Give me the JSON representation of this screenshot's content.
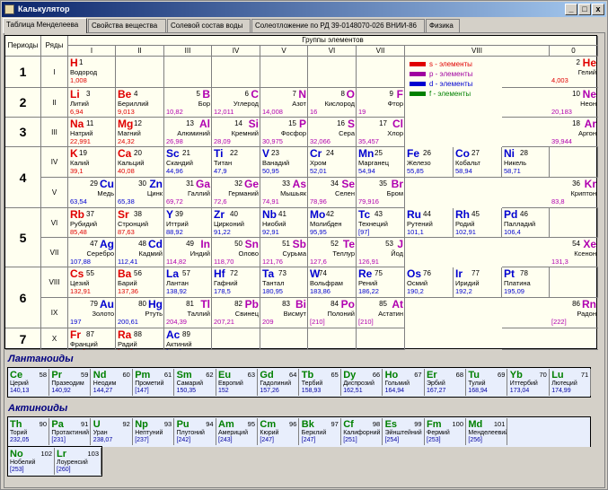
{
  "window": {
    "title": "Калькулятор",
    "min": "_",
    "max": "□",
    "close": "x"
  },
  "tabs": [
    "Таблица Менделеева",
    "Свойства вещества",
    "Солевой состав воды",
    "Солеотложение по РД 39-0148070-026 ВНИИ-86",
    "Физика"
  ],
  "headers": {
    "periods": "Периоды",
    "rows": "Ряды",
    "groups": "Группы элементов",
    "group_nums": [
      "I",
      "II",
      "III",
      "IV",
      "V",
      "VI",
      "VII",
      "VIII",
      "0"
    ]
  },
  "period_labels": [
    "1",
    "2",
    "3",
    "4",
    "5",
    "6",
    "7"
  ],
  "row_labels": [
    "I",
    "II",
    "III",
    "IV",
    "V",
    "VI",
    "VII",
    "VIII",
    "IX",
    "X"
  ],
  "legend": [
    {
      "label": "s - элементы",
      "color": "#e00000"
    },
    {
      "label": "p - элементы",
      "color": "#a000a0"
    },
    {
      "label": "d - элементы",
      "color": "#0000d0"
    },
    {
      "label": "f - элементы",
      "color": "#008000"
    }
  ],
  "colors": {
    "s": "#e00000",
    "p": "#b000b0",
    "d": "#0000d0",
    "f": "#008000"
  },
  "elements": [
    {
      "s": "H",
      "n": "1",
      "name": "Водород",
      "m": "1,008",
      "t": "s",
      "r": 0,
      "c": 0,
      "a": "l"
    },
    {
      "s": "He",
      "n": "2",
      "name": "Гелий",
      "m": "4,003",
      "t": "s",
      "r": 0,
      "c": 9,
      "a": "r"
    },
    {
      "s": "Li",
      "n": "3",
      "name": "Литий",
      "m": "6,94",
      "t": "s",
      "r": 1,
      "c": 0,
      "a": "l"
    },
    {
      "s": "Be",
      "n": "4",
      "name": "Бериллий",
      "m": "9,013",
      "t": "s",
      "r": 1,
      "c": 1,
      "a": "l"
    },
    {
      "s": "B",
      "n": "5",
      "name": "Бор",
      "m": "10,82",
      "t": "p",
      "r": 1,
      "c": 2,
      "a": "r"
    },
    {
      "s": "C",
      "n": "6",
      "name": "Углерод",
      "m": "12,011",
      "t": "p",
      "r": 1,
      "c": 3,
      "a": "r"
    },
    {
      "s": "N",
      "n": "7",
      "name": "Азот",
      "m": "14,008",
      "t": "p",
      "r": 1,
      "c": 4,
      "a": "r"
    },
    {
      "s": "O",
      "n": "8",
      "name": "Кислород",
      "m": "16",
      "t": "p",
      "r": 1,
      "c": 5,
      "a": "r"
    },
    {
      "s": "F",
      "n": "9",
      "name": "Фтор",
      "m": "19",
      "t": "p",
      "r": 1,
      "c": 6,
      "a": "r"
    },
    {
      "s": "Ne",
      "n": "10",
      "name": "Неон",
      "m": "20,183",
      "t": "p",
      "r": 1,
      "c": 9,
      "a": "r"
    },
    {
      "s": "Na",
      "n": "11",
      "name": "Натрий",
      "m": "22,991",
      "t": "s",
      "r": 2,
      "c": 0,
      "a": "l"
    },
    {
      "s": "Mg",
      "n": "12",
      "name": "Магний",
      "m": "24,32",
      "t": "s",
      "r": 2,
      "c": 1,
      "a": "l"
    },
    {
      "s": "Al",
      "n": "13",
      "name": "Алюминий",
      "m": "26,98",
      "t": "p",
      "r": 2,
      "c": 2,
      "a": "r"
    },
    {
      "s": "Si",
      "n": "14",
      "name": "Кремний",
      "m": "28,09",
      "t": "p",
      "r": 2,
      "c": 3,
      "a": "r"
    },
    {
      "s": "P",
      "n": "15",
      "name": "Фосфор",
      "m": "30,975",
      "t": "p",
      "r": 2,
      "c": 4,
      "a": "r"
    },
    {
      "s": "S",
      "n": "16",
      "name": "Сера",
      "m": "32,066",
      "t": "p",
      "r": 2,
      "c": 5,
      "a": "r"
    },
    {
      "s": "Cl",
      "n": "17",
      "name": "Хлор",
      "m": "35,457",
      "t": "p",
      "r": 2,
      "c": 6,
      "a": "r"
    },
    {
      "s": "Ar",
      "n": "18",
      "name": "Аргон",
      "m": "39,944",
      "t": "p",
      "r": 2,
      "c": 9,
      "a": "r"
    },
    {
      "s": "K",
      "n": "19",
      "name": "Калий",
      "m": "39,1",
      "t": "s",
      "r": 3,
      "c": 0,
      "a": "l"
    },
    {
      "s": "Ca",
      "n": "20",
      "name": "Кальций",
      "m": "40,08",
      "t": "s",
      "r": 3,
      "c": 1,
      "a": "l"
    },
    {
      "s": "Sc",
      "n": "21",
      "name": "Скандий",
      "m": "44,96",
      "t": "d",
      "r": 3,
      "c": 2,
      "a": "l"
    },
    {
      "s": "Ti",
      "n": "22",
      "name": "Титан",
      "m": "47,9",
      "t": "d",
      "r": 3,
      "c": 3,
      "a": "l"
    },
    {
      "s": "V",
      "n": "23",
      "name": "Ванадий",
      "m": "50,95",
      "t": "d",
      "r": 3,
      "c": 4,
      "a": "l"
    },
    {
      "s": "Cr",
      "n": "24",
      "name": "Хром",
      "m": "52,01",
      "t": "d",
      "r": 3,
      "c": 5,
      "a": "l"
    },
    {
      "s": "Mn",
      "n": "25",
      "name": "Марганец",
      "m": "54,94",
      "t": "d",
      "r": 3,
      "c": 6,
      "a": "l"
    },
    {
      "s": "Fe",
      "n": "26",
      "name": "Железо",
      "m": "55,85",
      "t": "d",
      "r": 3,
      "c": 7,
      "a": "l"
    },
    {
      "s": "Co",
      "n": "27",
      "name": "Кобальт",
      "m": "58,94",
      "t": "d",
      "r": 3,
      "c": 8,
      "a": "l"
    },
    {
      "s": "Ni",
      "n": "28",
      "name": "Никель",
      "m": "58,71",
      "t": "d",
      "r": 3,
      "c": 10,
      "a": "l"
    },
    {
      "s": "Cu",
      "n": "29",
      "name": "Медь",
      "m": "63,54",
      "t": "d",
      "r": 4,
      "c": 0,
      "a": "r"
    },
    {
      "s": "Zn",
      "n": "30",
      "name": "Цинк",
      "m": "65,38",
      "t": "d",
      "r": 4,
      "c": 1,
      "a": "r"
    },
    {
      "s": "Ga",
      "n": "31",
      "name": "Галлий",
      "m": "69,72",
      "t": "p",
      "r": 4,
      "c": 2,
      "a": "r"
    },
    {
      "s": "Ge",
      "n": "32",
      "name": "Германий",
      "m": "72,6",
      "t": "p",
      "r": 4,
      "c": 3,
      "a": "r"
    },
    {
      "s": "As",
      "n": "33",
      "name": "Мышьяк",
      "m": "74,91",
      "t": "p",
      "r": 4,
      "c": 4,
      "a": "r"
    },
    {
      "s": "Se",
      "n": "34",
      "name": "Селен",
      "m": "78,96",
      "t": "p",
      "r": 4,
      "c": 5,
      "a": "r"
    },
    {
      "s": "Br",
      "n": "35",
      "name": "Бром",
      "m": "79,916",
      "t": "p",
      "r": 4,
      "c": 6,
      "a": "r"
    },
    {
      "s": "Kr",
      "n": "36",
      "name": "Криптон",
      "m": "83,8",
      "t": "p",
      "r": 4,
      "c": 9,
      "a": "r"
    },
    {
      "s": "Rb",
      "n": "37",
      "name": "Рубидий",
      "m": "85,48",
      "t": "s",
      "r": 5,
      "c": 0,
      "a": "l"
    },
    {
      "s": "Sr",
      "n": "38",
      "name": "Стронций",
      "m": "87,63",
      "t": "s",
      "r": 5,
      "c": 1,
      "a": "l"
    },
    {
      "s": "Y",
      "n": "39",
      "name": "Иттрий",
      "m": "88,92",
      "t": "d",
      "r": 5,
      "c": 2,
      "a": "l"
    },
    {
      "s": "Zr",
      "n": "40",
      "name": "Цирконий",
      "m": "91,22",
      "t": "d",
      "r": 5,
      "c": 3,
      "a": "l"
    },
    {
      "s": "Nb",
      "n": "41",
      "name": "Ниобий",
      "m": "92,91",
      "t": "d",
      "r": 5,
      "c": 4,
      "a": "l"
    },
    {
      "s": "Mo",
      "n": "42",
      "name": "Молибден",
      "m": "95,95",
      "t": "d",
      "r": 5,
      "c": 5,
      "a": "l"
    },
    {
      "s": "Tc",
      "n": "43",
      "name": "Технеций",
      "m": "[97]",
      "t": "d",
      "r": 5,
      "c": 6,
      "a": "l"
    },
    {
      "s": "Ru",
      "n": "44",
      "name": "Рутений",
      "m": "101,1",
      "t": "d",
      "r": 5,
      "c": 7,
      "a": "l"
    },
    {
      "s": "Rh",
      "n": "45",
      "name": "Родий",
      "m": "102,91",
      "t": "d",
      "r": 5,
      "c": 8,
      "a": "l"
    },
    {
      "s": "Pd",
      "n": "46",
      "name": "Палладий",
      "m": "106,4",
      "t": "d",
      "r": 5,
      "c": 10,
      "a": "l"
    },
    {
      "s": "Ag",
      "n": "47",
      "name": "Серебро",
      "m": "107,88",
      "t": "d",
      "r": 6,
      "c": 0,
      "a": "r"
    },
    {
      "s": "Cd",
      "n": "48",
      "name": "Кадмий",
      "m": "112,41",
      "t": "d",
      "r": 6,
      "c": 1,
      "a": "r"
    },
    {
      "s": "In",
      "n": "49",
      "name": "Индий",
      "m": "114,82",
      "t": "p",
      "r": 6,
      "c": 2,
      "a": "r"
    },
    {
      "s": "Sn",
      "n": "50",
      "name": "Олово",
      "m": "118,70",
      "t": "p",
      "r": 6,
      "c": 3,
      "a": "r"
    },
    {
      "s": "Sb",
      "n": "51",
      "name": "Сурьма",
      "m": "121,76",
      "t": "p",
      "r": 6,
      "c": 4,
      "a": "r"
    },
    {
      "s": "Te",
      "n": "52",
      "name": "Теллур",
      "m": "127,6",
      "t": "p",
      "r": 6,
      "c": 5,
      "a": "r"
    },
    {
      "s": "J",
      "n": "53",
      "name": "Йод",
      "m": "126,91",
      "t": "p",
      "r": 6,
      "c": 6,
      "a": "r"
    },
    {
      "s": "Xe",
      "n": "54",
      "name": "Ксенон",
      "m": "131,3",
      "t": "p",
      "r": 6,
      "c": 9,
      "a": "r"
    },
    {
      "s": "Cs",
      "n": "55",
      "name": "Цезий",
      "m": "132,91",
      "t": "s",
      "r": 7,
      "c": 0,
      "a": "l"
    },
    {
      "s": "Ba",
      "n": "56",
      "name": "Барий",
      "m": "137,36",
      "t": "s",
      "r": 7,
      "c": 1,
      "a": "l"
    },
    {
      "s": "La",
      "n": "57",
      "name": "Лантан",
      "m": "138,92",
      "t": "d",
      "r": 7,
      "c": 2,
      "a": "l"
    },
    {
      "s": "Hf",
      "n": "72",
      "name": "Гафний",
      "m": "178,5",
      "t": "d",
      "r": 7,
      "c": 3,
      "a": "l"
    },
    {
      "s": "Ta",
      "n": "73",
      "name": "Тантал",
      "m": "180,95",
      "t": "d",
      "r": 7,
      "c": 4,
      "a": "l"
    },
    {
      "s": "W",
      "n": "74",
      "name": "Вольфрам",
      "m": "183,86",
      "t": "d",
      "r": 7,
      "c": 5,
      "a": "l"
    },
    {
      "s": "Re",
      "n": "75",
      "name": "Рений",
      "m": "186,22",
      "t": "d",
      "r": 7,
      "c": 6,
      "a": "l"
    },
    {
      "s": "Os",
      "n": "76",
      "name": "Осмий",
      "m": "190,2",
      "t": "d",
      "r": 7,
      "c": 7,
      "a": "l"
    },
    {
      "s": "Ir",
      "n": "77",
      "name": "Иридий",
      "m": "192,2",
      "t": "d",
      "r": 7,
      "c": 8,
      "a": "l"
    },
    {
      "s": "Pt",
      "n": "78",
      "name": "Платина",
      "m": "195,09",
      "t": "d",
      "r": 7,
      "c": 10,
      "a": "l"
    },
    {
      "s": "Au",
      "n": "79",
      "name": "Золото",
      "m": "197",
      "t": "d",
      "r": 8,
      "c": 0,
      "a": "r"
    },
    {
      "s": "Hg",
      "n": "80",
      "name": "Ртуть",
      "m": "200,61",
      "t": "d",
      "r": 8,
      "c": 1,
      "a": "r"
    },
    {
      "s": "Tl",
      "n": "81",
      "name": "Таллий",
      "m": "204,39",
      "t": "p",
      "r": 8,
      "c": 2,
      "a": "r"
    },
    {
      "s": "Pb",
      "n": "82",
      "name": "Свинец",
      "m": "207,21",
      "t": "p",
      "r": 8,
      "c": 3,
      "a": "r"
    },
    {
      "s": "Bi",
      "n": "83",
      "name": "Висмут",
      "m": "209",
      "t": "p",
      "r": 8,
      "c": 4,
      "a": "r"
    },
    {
      "s": "Po",
      "n": "84",
      "name": "Полоний",
      "m": "[210]",
      "t": "p",
      "r": 8,
      "c": 5,
      "a": "r"
    },
    {
      "s": "At",
      "n": "85",
      "name": "Астатин",
      "m": "[210]",
      "t": "p",
      "r": 8,
      "c": 6,
      "a": "r"
    },
    {
      "s": "Rn",
      "n": "86",
      "name": "Радон",
      "m": "[222]",
      "t": "p",
      "r": 8,
      "c": 9,
      "a": "r"
    },
    {
      "s": "Fr",
      "n": "87",
      "name": "Франций",
      "m": "[223]",
      "t": "s",
      "r": 9,
      "c": 0,
      "a": "l"
    },
    {
      "s": "Ra",
      "n": "88",
      "name": "Радий",
      "m": "[226]",
      "t": "s",
      "r": 9,
      "c": 1,
      "a": "l"
    },
    {
      "s": "Ac",
      "n": "89",
      "name": "Актиний",
      "m": "[227]",
      "t": "d",
      "r": 9,
      "c": 2,
      "a": "l"
    }
  ],
  "lanthanides_title": "Лантаноиды",
  "lanthanides": [
    {
      "s": "Ce",
      "n": "58",
      "name": "Церий",
      "m": "140,13"
    },
    {
      "s": "Pr",
      "n": "59",
      "name": "Празеодим",
      "m": "140,92"
    },
    {
      "s": "Nd",
      "n": "60",
      "name": "Неодим",
      "m": "144,27"
    },
    {
      "s": "Pm",
      "n": "61",
      "name": "Прометий",
      "m": "[147]"
    },
    {
      "s": "Sm",
      "n": "62",
      "name": "Самарий",
      "m": "150,35"
    },
    {
      "s": "Eu",
      "n": "63",
      "name": "Европий",
      "m": "152"
    },
    {
      "s": "Gd",
      "n": "64",
      "name": "Гадолиний",
      "m": "157,26"
    },
    {
      "s": "Tb",
      "n": "65",
      "name": "Тербий",
      "m": "158,93"
    },
    {
      "s": "Dy",
      "n": "66",
      "name": "Диспрозий",
      "m": "162,51"
    },
    {
      "s": "Ho",
      "n": "67",
      "name": "Гольмий",
      "m": "164,94"
    },
    {
      "s": "Er",
      "n": "68",
      "name": "Эрбий",
      "m": "167,27"
    },
    {
      "s": "Tu",
      "n": "69",
      "name": "Тулий",
      "m": "168,94"
    },
    {
      "s": "Yb",
      "n": "70",
      "name": "Иттербий",
      "m": "173,04"
    },
    {
      "s": "Lu",
      "n": "71",
      "name": "Лютеций",
      "m": "174,99"
    }
  ],
  "actinides_title": "Актиноиды",
  "actinides": [
    {
      "s": "Th",
      "n": "90",
      "name": "Торий",
      "m": "232,05"
    },
    {
      "s": "Pa",
      "n": "91",
      "name": "Протактиний",
      "m": "[231]"
    },
    {
      "s": "U",
      "n": "92",
      "name": "Уран",
      "m": "238,07"
    },
    {
      "s": "Np",
      "n": "93",
      "name": "Нептуний",
      "m": "[237]"
    },
    {
      "s": "Pu",
      "n": "94",
      "name": "Плутоний",
      "m": "[242]"
    },
    {
      "s": "Am",
      "n": "95",
      "name": "Америций",
      "m": "[243]"
    },
    {
      "s": "Cm",
      "n": "96",
      "name": "Кюрий",
      "m": "[247]"
    },
    {
      "s": "Bk",
      "n": "97",
      "name": "Берклий",
      "m": "[247]"
    },
    {
      "s": "Cf",
      "n": "98",
      "name": "Калифорний",
      "m": "[251]"
    },
    {
      "s": "Es",
      "n": "99",
      "name": "Эйнштейний",
      "m": "[254]"
    },
    {
      "s": "Fm",
      "n": "100",
      "name": "Фермий",
      "m": "[253]"
    },
    {
      "s": "Md",
      "n": "101",
      "name": "Менделеевий",
      "m": "[256]"
    },
    {
      "s": "No",
      "n": "102",
      "name": "Нобелий",
      "m": "[253]"
    },
    {
      "s": "Lr",
      "n": "103",
      "name": "Лоуренсий",
      "m": "[260]"
    }
  ]
}
